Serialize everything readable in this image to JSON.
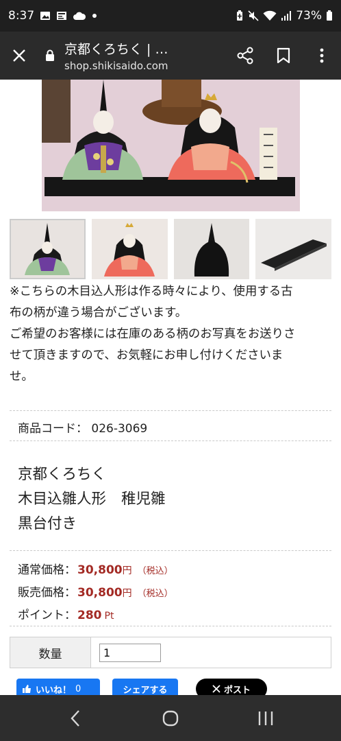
{
  "status_bar": {
    "time": "8:37",
    "battery": "73%",
    "icons": [
      "gallery-icon",
      "news-icon",
      "cloud-icon",
      "dot-icon",
      "battery-saver-icon",
      "mute-icon",
      "wifi-icon",
      "signal-icon",
      "battery-icon"
    ]
  },
  "app_bar": {
    "title": "京都くろちく | …",
    "url": "shop.shikisaido.com",
    "icons": [
      "close-icon",
      "lock-icon",
      "share-icon",
      "bookmark-icon",
      "more-icon"
    ]
  },
  "product": {
    "note_lines": [
      "※こちらの木目込人形は作る時々により、使用する古",
      "布の柄が違う場合がございます。",
      "ご希望のお客様には在庫のある柄のお写真をお送りさ",
      "せて頂きますので、お気軽にお申し付けくださいま",
      "せ。"
    ],
    "code_label": "商品コード：",
    "code_value": "026-3069",
    "title_line1": "京都くろちく",
    "title_line2a": "木目込雛人形",
    "title_line2b": "稚児雛",
    "title_line3": "黒台付き",
    "prices": {
      "regular_label": "通常価格：",
      "regular_value": "30,800",
      "sale_label": "販売価格：",
      "sale_value": "30,800",
      "yen": "円",
      "tax": "（税込）",
      "point_label": "ポイント：",
      "point_value": "280",
      "point_unit": "Pt"
    },
    "quantity_label": "数量",
    "quantity_value": "1"
  },
  "social": {
    "like_label": "いいね！",
    "like_count": "0",
    "share_label": "シェアする",
    "post_label": "ポスト"
  },
  "nav": {
    "icons": [
      "back-icon",
      "home-icon",
      "recents-icon"
    ]
  },
  "colors": {
    "price": "#a32a24",
    "facebook": "#1877f2",
    "status_bar": "#1f1f1f",
    "app_bar": "#2b2b2b",
    "nav_bar": "#2d2d2d"
  }
}
